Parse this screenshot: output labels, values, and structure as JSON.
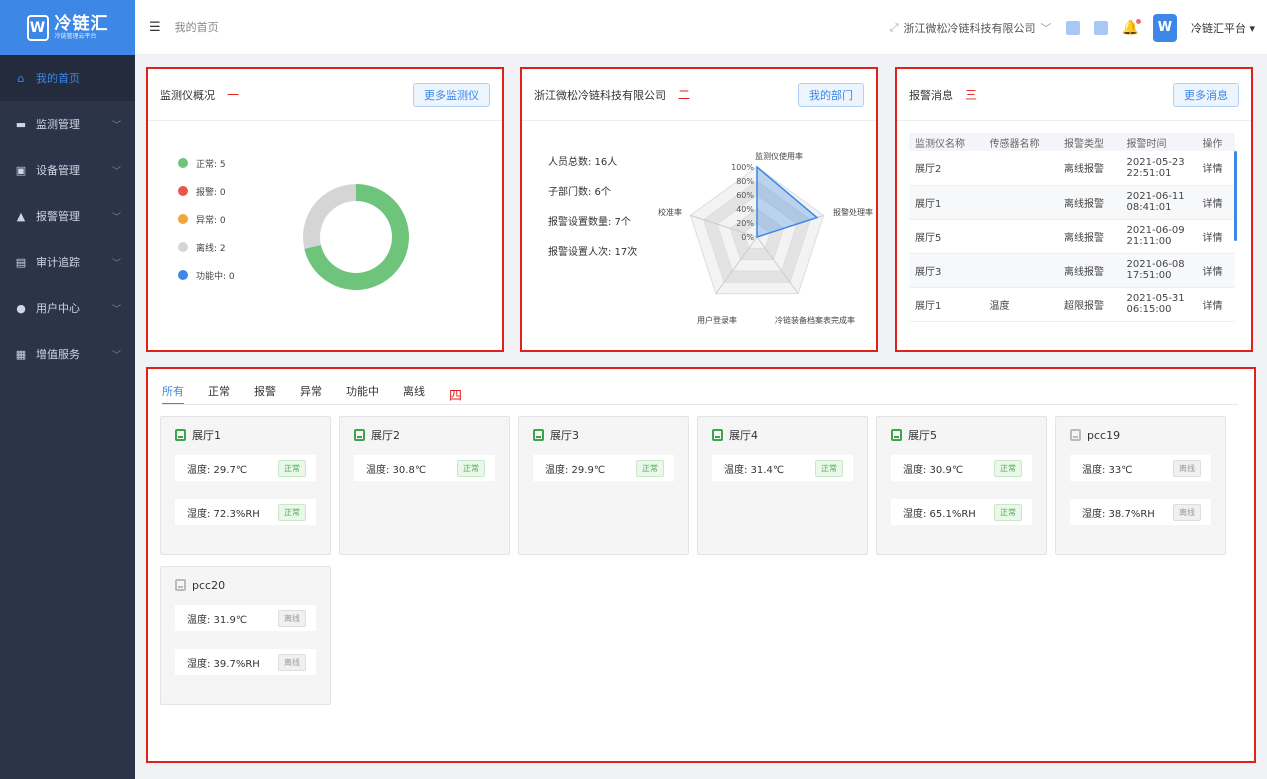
{
  "sidebar": {
    "logo_title": "冷链汇",
    "logo_sub": "冷链管理云平台",
    "items": [
      {
        "label": "我的首页",
        "icon": "home-icon",
        "active": true
      },
      {
        "label": "监测管理",
        "icon": "monitor-icon",
        "active": false
      },
      {
        "label": "设备管理",
        "icon": "device-icon",
        "active": false
      },
      {
        "label": "报警管理",
        "icon": "alarm-icon",
        "active": false
      },
      {
        "label": "审计追踪",
        "icon": "audit-icon",
        "active": false
      },
      {
        "label": "用户中心",
        "icon": "user-icon",
        "active": false
      },
      {
        "label": "增值服务",
        "icon": "grid-icon",
        "active": false
      }
    ]
  },
  "header": {
    "title": "我的首页",
    "org": "浙江微松冷链科技有限公司",
    "user": "冷链汇平台"
  },
  "panel1": {
    "title": "监测仪概况",
    "mark": "一",
    "button": "更多监测仪",
    "legend": [
      {
        "label": "正常: 5",
        "color": "#6fc47b"
      },
      {
        "label": "报警: 0",
        "color": "#e8574c"
      },
      {
        "label": "异常: 0",
        "color": "#f2a53a"
      },
      {
        "label": "离线: 2",
        "color": "#d5d5d5"
      },
      {
        "label": "功能中: 0",
        "color": "#3d87e6"
      }
    ],
    "donut": {
      "normal": 5,
      "offline": 2
    }
  },
  "panel2": {
    "title": "浙江微松冷链科技有限公司",
    "mark": "二",
    "button": "我的部门",
    "stats": [
      "人员总数: 16人",
      "子部门数: 6个",
      "报警设置数量: 7个",
      "报警设置人次: 17次"
    ],
    "radar": {
      "axes": [
        "监测仪使用率",
        "报警处理率",
        "冷链装备档案表完成率",
        "用户登录率",
        "校准率"
      ],
      "values": [
        100,
        90,
        0,
        0,
        0
      ],
      "ticks": [
        "100%",
        "80%",
        "60%",
        "40%",
        "20%",
        "0%"
      ]
    }
  },
  "panel3": {
    "title": "报警消息",
    "mark": "三",
    "button": "更多消息",
    "columns": [
      "监测仪名称",
      "传感器名称",
      "报警类型",
      "报警时间",
      "操作"
    ],
    "rows": [
      {
        "name": "展厅2",
        "sensor": "",
        "type": "离线报警",
        "time": "2021-05-23 22:51:01",
        "action": "详情"
      },
      {
        "name": "展厅1",
        "sensor": "",
        "type": "离线报警",
        "time": "2021-06-11 08:41:01",
        "action": "详情"
      },
      {
        "name": "展厅5",
        "sensor": "",
        "type": "离线报警",
        "time": "2021-06-09 21:11:00",
        "action": "详情"
      },
      {
        "name": "展厅3",
        "sensor": "",
        "type": "离线报警",
        "time": "2021-06-08 17:51:00",
        "action": "详情"
      },
      {
        "name": "展厅1",
        "sensor": "温度",
        "type": "超限报警",
        "time": "2021-05-31 06:15:00",
        "action": "详情"
      }
    ]
  },
  "panel4": {
    "mark": "四",
    "tabs": [
      "所有",
      "正常",
      "报警",
      "异常",
      "功能中",
      "离线"
    ],
    "devices": [
      {
        "name": "展厅1",
        "online": true,
        "readings": [
          {
            "text": "温度: 29.7℃",
            "status": "正常"
          },
          {
            "text": "湿度: 72.3%RH",
            "status": "正常"
          }
        ]
      },
      {
        "name": "展厅2",
        "online": true,
        "readings": [
          {
            "text": "温度: 30.8℃",
            "status": "正常"
          }
        ]
      },
      {
        "name": "展厅3",
        "online": true,
        "readings": [
          {
            "text": "温度: 29.9℃",
            "status": "正常"
          }
        ]
      },
      {
        "name": "展厅4",
        "online": true,
        "readings": [
          {
            "text": "温度: 31.4℃",
            "status": "正常"
          }
        ]
      },
      {
        "name": "展厅5",
        "online": true,
        "readings": [
          {
            "text": "温度: 30.9℃",
            "status": "正常"
          },
          {
            "text": "湿度: 65.1%RH",
            "status": "正常"
          }
        ]
      },
      {
        "name": "pcc19",
        "online": false,
        "readings": [
          {
            "text": "温度: 33℃",
            "status": "离线"
          },
          {
            "text": "湿度: 38.7%RH",
            "status": "离线"
          }
        ]
      },
      {
        "name": "pcc20",
        "online": false,
        "readings": [
          {
            "text": "温度: 31.9℃",
            "status": "离线"
          },
          {
            "text": "湿度: 39.7%RH",
            "status": "离线"
          }
        ]
      }
    ]
  }
}
